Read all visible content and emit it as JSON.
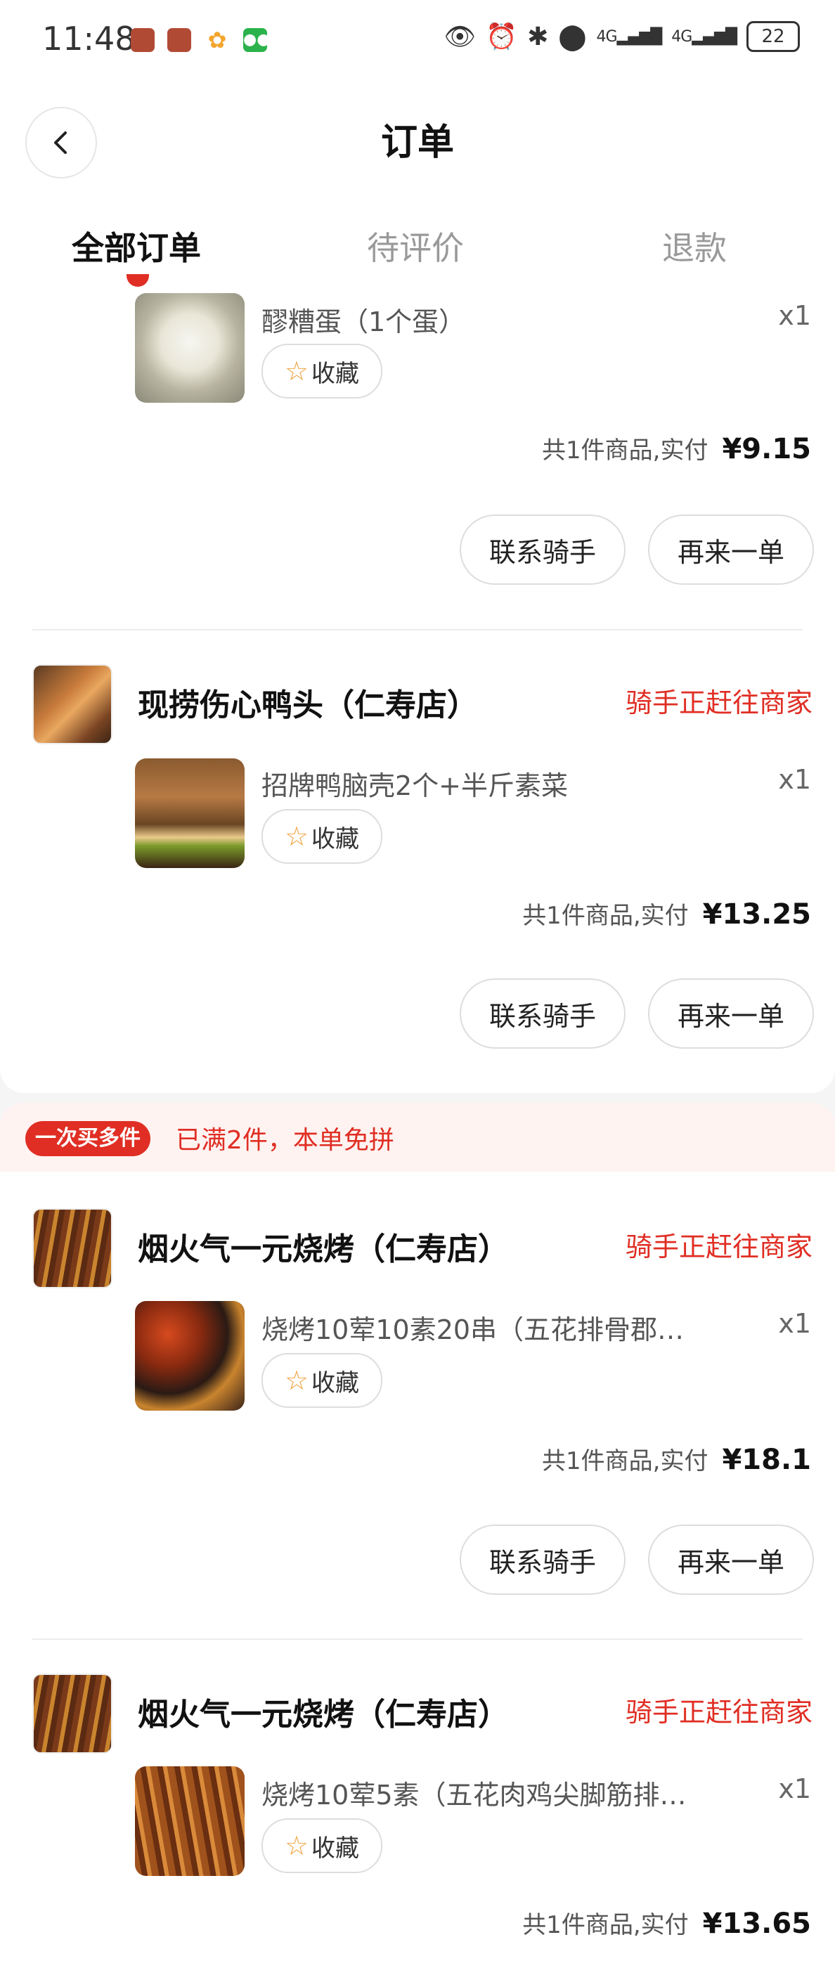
{
  "status_bar": {
    "time": "11:48",
    "battery": "22",
    "signal_1": "4G",
    "signal_2": "4G"
  },
  "header": {
    "title": "订单",
    "tabs": [
      {
        "label": "全部订单",
        "active": true
      },
      {
        "label": "待评价",
        "active": false
      },
      {
        "label": "退款",
        "active": false
      }
    ]
  },
  "orders": [
    {
      "store": "",
      "status": "",
      "item": {
        "name": "醪糟蛋（1个蛋）",
        "qty": "x1",
        "fav_label": "收藏"
      },
      "summary": "共1件商品,实付",
      "price": "¥9.15",
      "actions": [
        "联系骑手",
        "再来一单"
      ]
    },
    {
      "store": "现捞伤心鸭头（仁寿店）",
      "status": "骑手正赶往商家",
      "item": {
        "name": "招牌鸭脑壳2个+半斤素菜",
        "qty": "x1",
        "fav_label": "收藏"
      },
      "summary": "共1件商品,实付",
      "price": "¥13.25",
      "actions": [
        "联系骑手",
        "再来一单"
      ]
    },
    {
      "store": "烟火气一元烧烤（仁寿店）",
      "status": "骑手正赶往商家",
      "item": {
        "name": "烧烤10荤10素20串（五花排骨郡…",
        "qty": "x1",
        "fav_label": "收藏"
      },
      "summary": "共1件商品,实付",
      "price": "¥18.1",
      "actions": [
        "联系骑手",
        "再来一单"
      ]
    },
    {
      "store": "烟火气一元烧烤（仁寿店）",
      "status": "骑手正赶往商家",
      "item": {
        "name": "烧烤10荤5素（五花肉鸡尖脚筋排…",
        "qty": "x1",
        "fav_label": "收藏"
      },
      "summary": "共1件商品,实付",
      "price": "¥13.65",
      "actions": []
    }
  ],
  "promo": {
    "badge": "一次买多件",
    "text": "已满2件，本单免拼"
  },
  "colors": {
    "accent": "#e02e24",
    "background": "#f5f5f5",
    "card": "#ffffff",
    "promo_bg": "#fff3f1"
  }
}
